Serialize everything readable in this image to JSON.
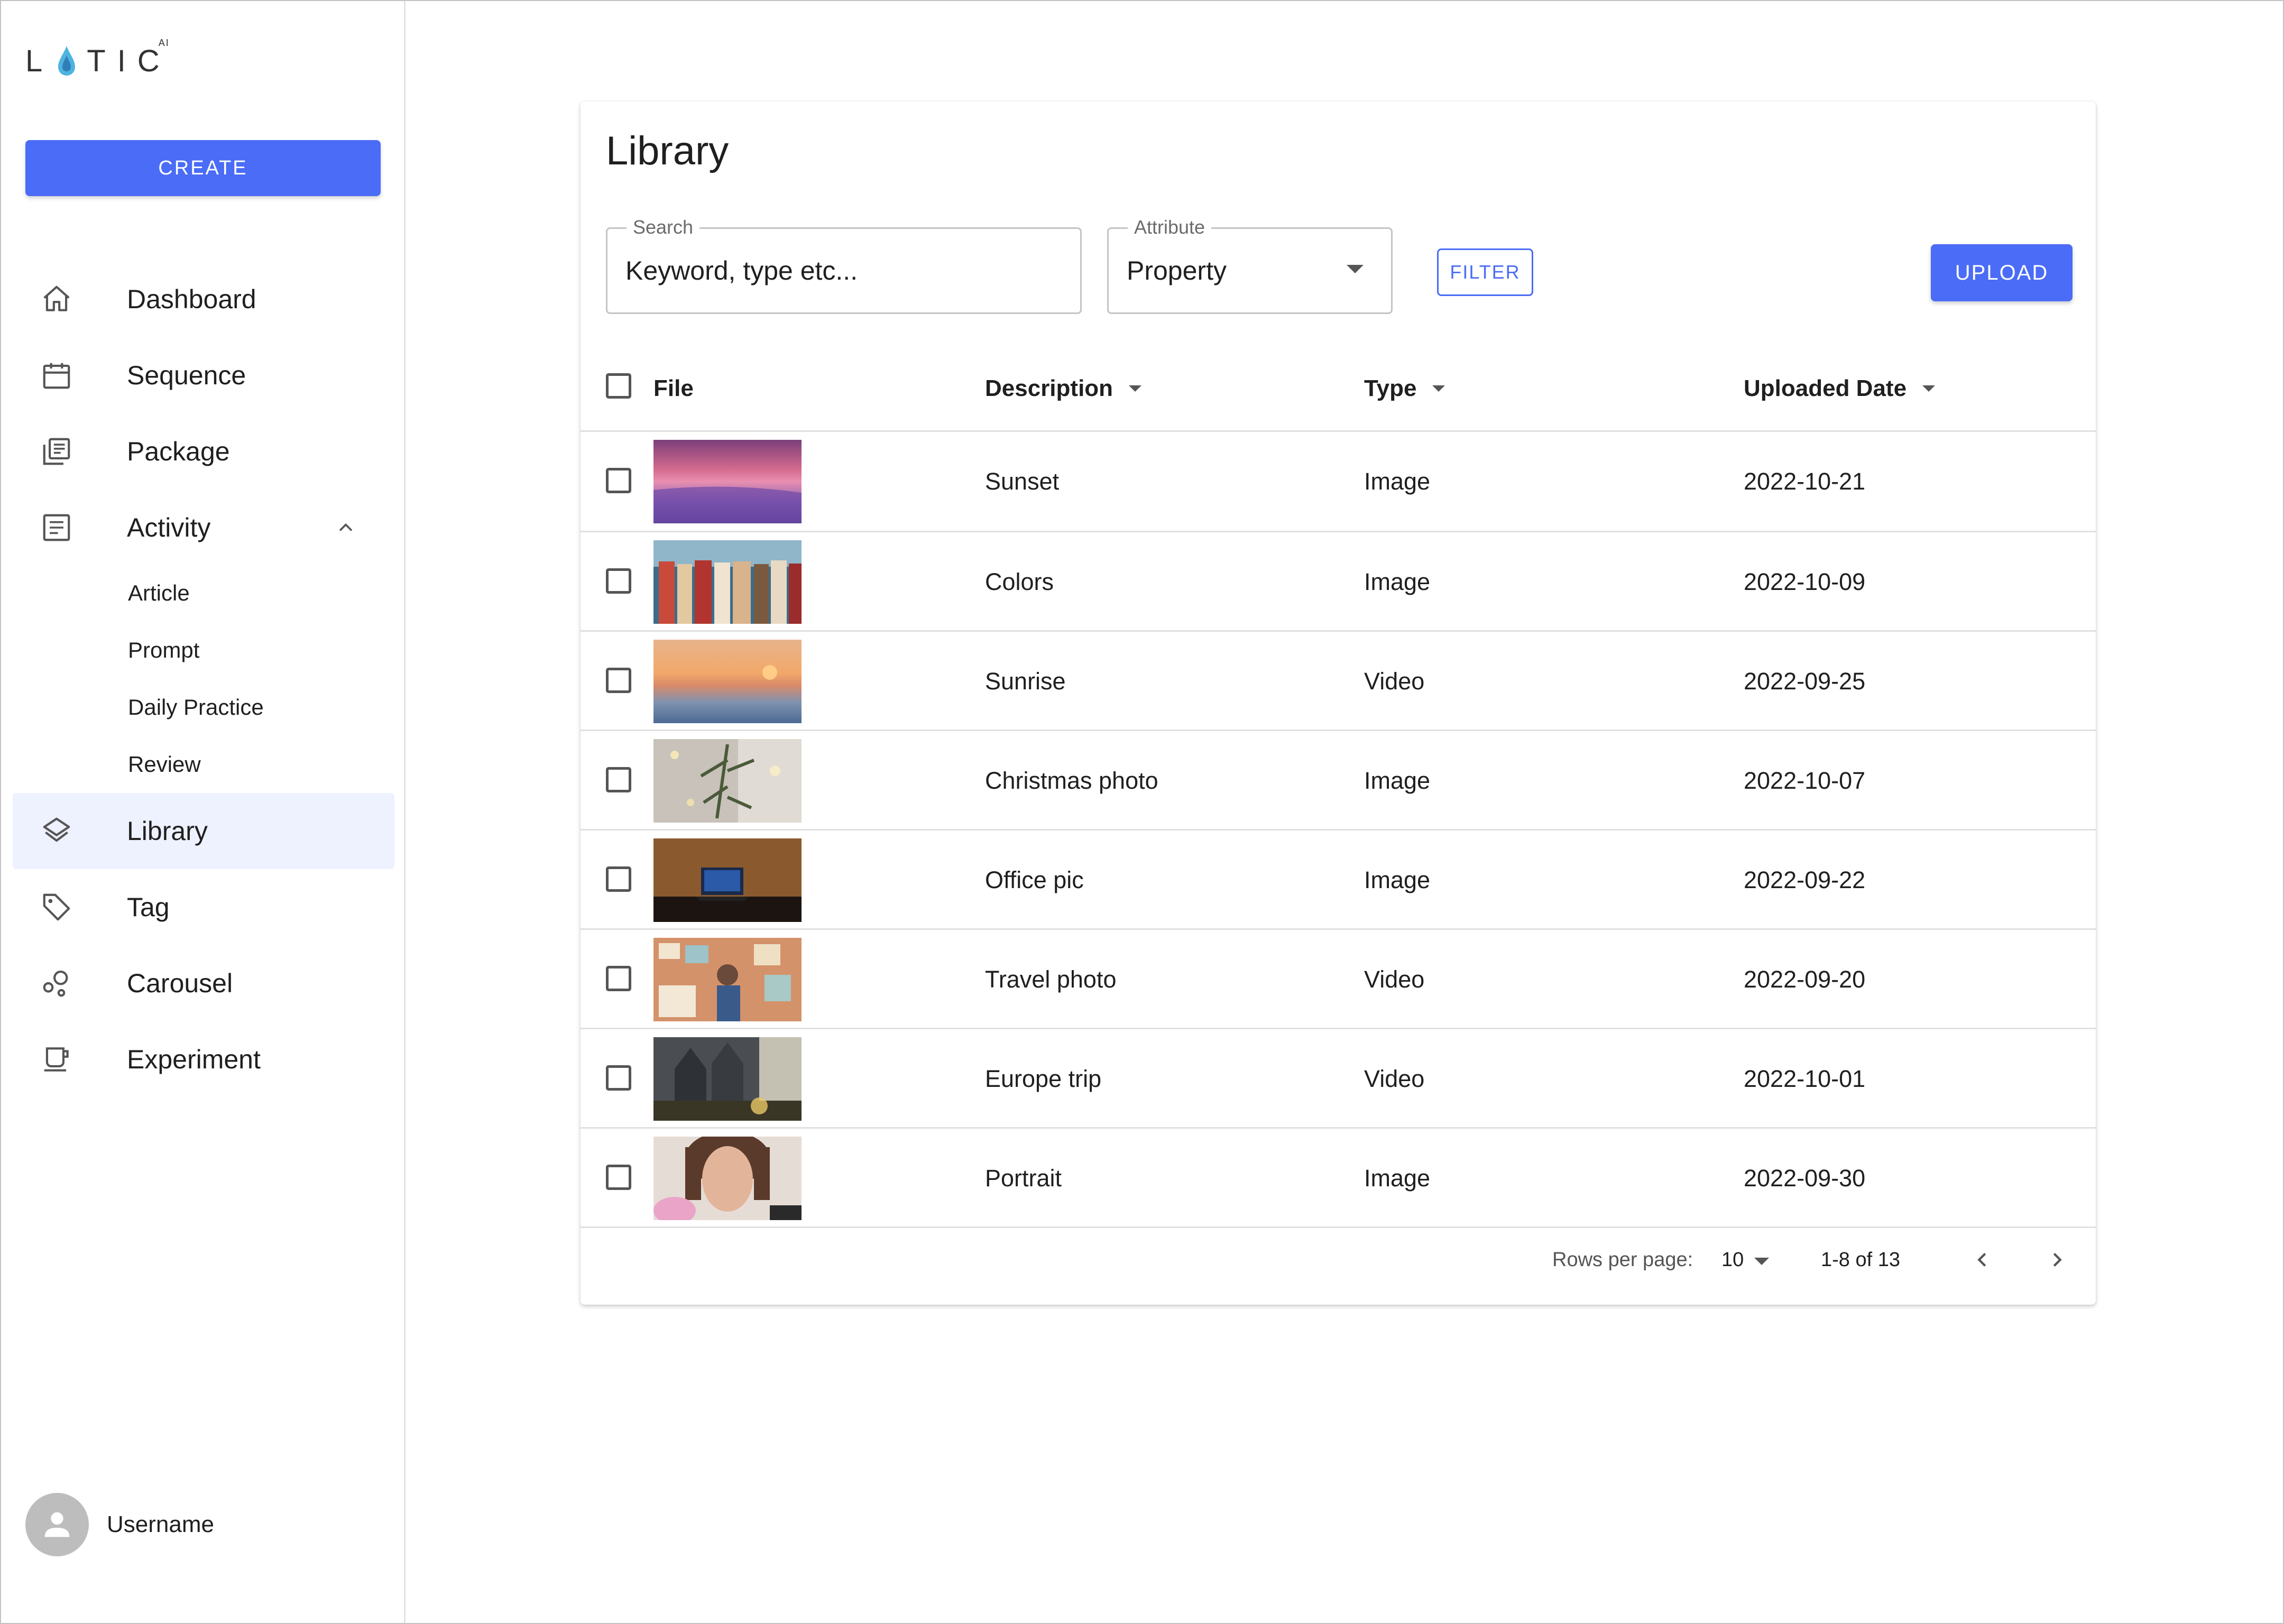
{
  "brand": {
    "logo_text": "LTIC",
    "logo_prefix": "L",
    "logo_suffix": "TIC",
    "logo_ai": "AI"
  },
  "sidebar": {
    "create_label": "CREATE",
    "items": [
      {
        "label": "Dashboard",
        "icon": "home-icon"
      },
      {
        "label": "Sequence",
        "icon": "calendar-icon"
      },
      {
        "label": "Package",
        "icon": "library-books-icon"
      },
      {
        "label": "Activity",
        "icon": "article-icon"
      },
      {
        "label": "Library",
        "icon": "layers-icon"
      },
      {
        "label": "Tag",
        "icon": "tag-icon"
      },
      {
        "label": "Carousel",
        "icon": "bubble-chart-icon"
      },
      {
        "label": "Experiment",
        "icon": "coffee-icon"
      }
    ],
    "activity_sub": [
      "Article",
      "Prompt",
      "Daily Practice",
      "Review"
    ],
    "active": "Library",
    "user": {
      "name": "Username"
    }
  },
  "page": {
    "title": "Library",
    "search": {
      "legend": "Search",
      "placeholder": "Keyword, type etc..."
    },
    "attribute": {
      "legend": "Attribute",
      "value": "Property"
    },
    "filter_label": "FILTER",
    "upload_label": "UPLOAD"
  },
  "table": {
    "headers": {
      "file": "File",
      "description": "Description",
      "type": "Type",
      "date": "Uploaded Date"
    },
    "rows": [
      {
        "description": "Sunset",
        "type": "Image",
        "date": "2022-10-21"
      },
      {
        "description": "Colors",
        "type": "Image",
        "date": "2022-10-09"
      },
      {
        "description": "Sunrise",
        "type": "Video",
        "date": "2022-09-25"
      },
      {
        "description": "Christmas photo",
        "type": "Image",
        "date": "2022-10-07"
      },
      {
        "description": "Office pic",
        "type": "Image",
        "date": "2022-09-22"
      },
      {
        "description": "Travel photo",
        "type": "Video",
        "date": "2022-09-20"
      },
      {
        "description": "Europe trip",
        "type": "Video",
        "date": "2022-10-01"
      },
      {
        "description": "Portrait",
        "type": "Image",
        "date": "2022-09-30"
      }
    ],
    "footer": {
      "rows_per_page_label": "Rows per page:",
      "rows_per_page": "10",
      "range": "1-8 of 13"
    }
  },
  "colors": {
    "accent": "#4a6cf7",
    "active_bg": "#eef1fe"
  }
}
